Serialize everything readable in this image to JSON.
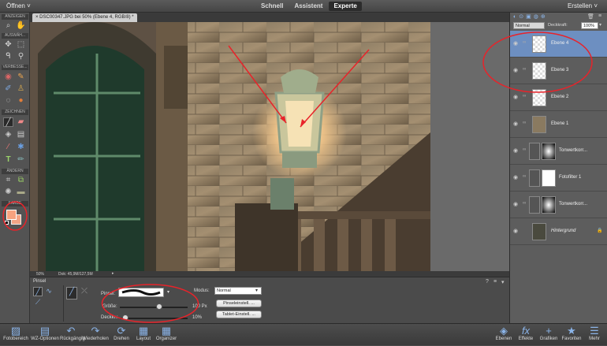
{
  "menubar": {
    "open": "Öffnen ˅",
    "modes": [
      "Schnell",
      "Assistent",
      "Experte"
    ],
    "create": "Erstellen ˅"
  },
  "document_tab": "× DSC00347.JPG bei 50% (Ebene 4, RGB/8) *",
  "toolbox": {
    "sections": [
      "ANZEIGEN",
      "AUSWÄH...",
      "VERBESSE...",
      "ZEICHNEN",
      "ÄNDERN",
      "FARBE"
    ]
  },
  "status": {
    "zoom": "50%",
    "doc": "Dok: 45,9M/127,5M"
  },
  "options": {
    "title": "Pinsel",
    "brush_label": "Pinsel:",
    "size_label": "Größe:",
    "size_value": "100 Px",
    "opacity_label": "Deckkr.:",
    "opacity_value": "10%",
    "mode_label": "Modus:",
    "mode_value": "Normal",
    "brush_settings_button": "Pinseleinstell. ...",
    "tablet_settings_button": "Tablet-Einstell. ...",
    "size_fraction": 0.58,
    "opacity_fraction": 0.08
  },
  "layers_panel": {
    "blend_mode": "Normal",
    "opacity_label": "Deckkraft:",
    "opacity_value": "100%",
    "layers": [
      {
        "name": "Ebene 4",
        "selected": true
      },
      {
        "name": "Ebene 3",
        "selected": false
      },
      {
        "name": "Ebene 2",
        "selected": false
      },
      {
        "name": "Ebene 1",
        "selected": false
      },
      {
        "name": "Tonwertkorr...",
        "selected": false
      },
      {
        "name": "Fotofilter 1",
        "selected": false
      },
      {
        "name": "Tonwertkorr...",
        "selected": false
      },
      {
        "name": "Hintergrund",
        "selected": false
      }
    ]
  },
  "bottom_bar": {
    "left": [
      "Fotobereich",
      "WZ-Optionen",
      "Rückgängig",
      "Wiederholen",
      "Drehen",
      "Layout",
      "Organizer"
    ],
    "right": [
      "Ebenen",
      "Effekte",
      "Grafiken",
      "Favoriten",
      "Mehr"
    ]
  },
  "colors": {
    "accent": "#6d8fc1",
    "annotation": "#e8232a"
  }
}
